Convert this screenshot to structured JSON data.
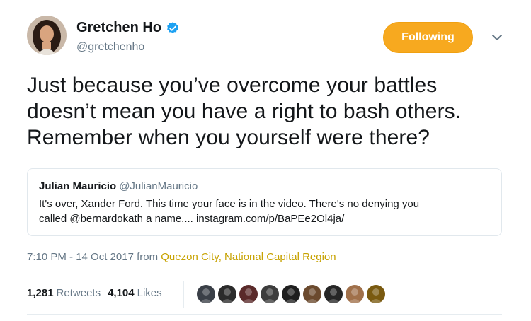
{
  "author": {
    "name": "Gretchen Ho",
    "handle": "@gretchenho",
    "verified": true,
    "follow_label": "Following",
    "avatar_icon": "profile-photo"
  },
  "tweet": {
    "lines": [
      "Just because you’ve overcome your battles",
      "doesn’t mean you have a right to bash others.",
      "Remember when you yourself were there?"
    ]
  },
  "quote": {
    "name": "Julian Mauricio",
    "handle": "@JulianMauricio",
    "lines": [
      "It's over, Xander Ford. This time your face is in the video. There's no denying you",
      "called @bernardokath a name.... instagram.com/p/BaPEe2Ol4ja/"
    ]
  },
  "meta": {
    "time": "7:10 PM - 14 Oct 2017 from ",
    "location": "Quezon City, National Capital Region"
  },
  "stats": {
    "retweets_count": "1,281",
    "retweets_label": "Retweets",
    "likes_count": "4,104",
    "likes_label": "Likes"
  },
  "colors": {
    "follow_button": "#f7a91f",
    "location_link": "#c7a200",
    "verified_badge": "#1da1f2"
  },
  "likers": [
    {
      "color": "#3a3f47"
    },
    {
      "color": "#2b2b2b"
    },
    {
      "color": "#5a2a2a"
    },
    {
      "color": "#3d3d3d"
    },
    {
      "color": "#1f1f1f"
    },
    {
      "color": "#6b4a2e"
    },
    {
      "color": "#262626"
    },
    {
      "color": "#a0704a"
    },
    {
      "color": "#7a5a10"
    }
  ]
}
